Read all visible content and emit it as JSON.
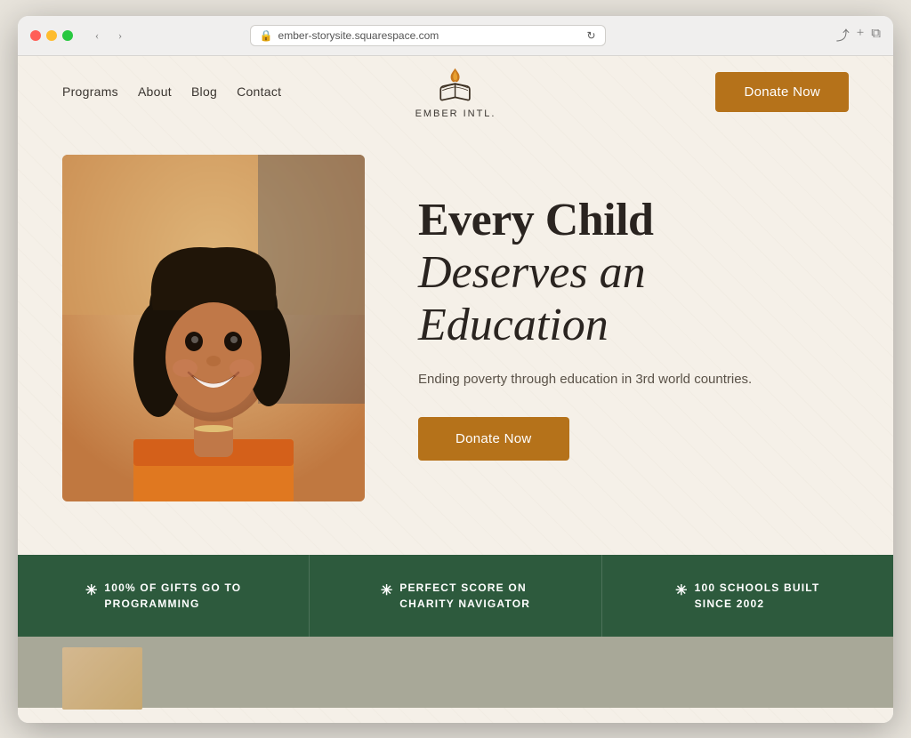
{
  "browser": {
    "url": "ember-storysite.squarespace.com",
    "back_label": "‹",
    "forward_label": "›",
    "share_label": "⎋",
    "new_tab_label": "+",
    "windows_label": "⧉"
  },
  "nav": {
    "items": [
      {
        "label": "Programs",
        "id": "programs"
      },
      {
        "label": "About",
        "id": "about"
      },
      {
        "label": "Blog",
        "id": "blog"
      },
      {
        "label": "Contact",
        "id": "contact"
      }
    ]
  },
  "logo": {
    "name": "EMBER INTL.",
    "alt": "Ember International logo"
  },
  "header": {
    "donate_label": "Donate Now"
  },
  "hero": {
    "title_line1": "Every Child",
    "title_line2": "Deserves an",
    "title_line3": "Education",
    "subtitle": "Ending poverty through education in 3rd world countries.",
    "donate_label": "Donate Now",
    "image_alt": "Smiling child"
  },
  "stats": [
    {
      "asterisk": "✳",
      "text_line1": "100% OF GIFTS GO TO",
      "text_line2": "PROGRAMMING"
    },
    {
      "asterisk": "✳",
      "text_line1": "PERFECT SCORE ON",
      "text_line2": "CHARITY NAVIGATOR"
    },
    {
      "asterisk": "✳",
      "text_line1": "100 SCHOOLS BUILT",
      "text_line2": "SINCE 2002"
    }
  ],
  "colors": {
    "donate_bg": "#b5721a",
    "stats_bg": "#2d5a3d",
    "page_bg": "#f5f0e8"
  }
}
